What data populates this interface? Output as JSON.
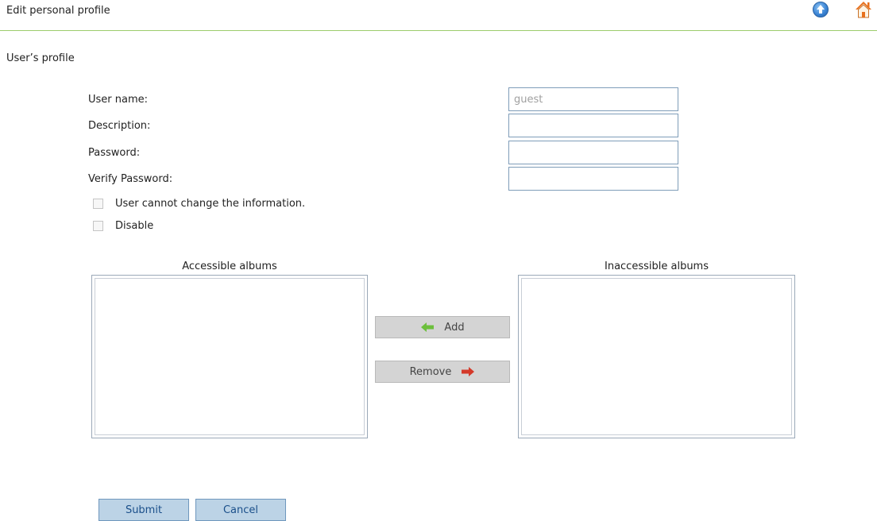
{
  "header": {
    "title": "Edit personal profile",
    "icons": [
      "up-arrow-icon",
      "home-icon"
    ],
    "accent_color": "#9ccc6c"
  },
  "section": {
    "title": "User’s profile"
  },
  "form": {
    "username_label": "User name:",
    "username_value": "guest",
    "description_label": "Description:",
    "description_value": "",
    "password_label": "Password:",
    "password_value": "",
    "verify_label": "Verify Password:",
    "verify_value": ""
  },
  "options": {
    "cannot_change_label": "User cannot change the information.",
    "cannot_change_checked": false,
    "disable_label": "Disable",
    "disable_checked": false
  },
  "albums": {
    "accessible_title": "Accessible albums",
    "accessible_items": [],
    "inaccessible_title": "Inaccessible albums",
    "inaccessible_items": [],
    "add_label": "Add",
    "remove_label": "Remove"
  },
  "actions": {
    "submit_label": "Submit",
    "cancel_label": "Cancel"
  }
}
